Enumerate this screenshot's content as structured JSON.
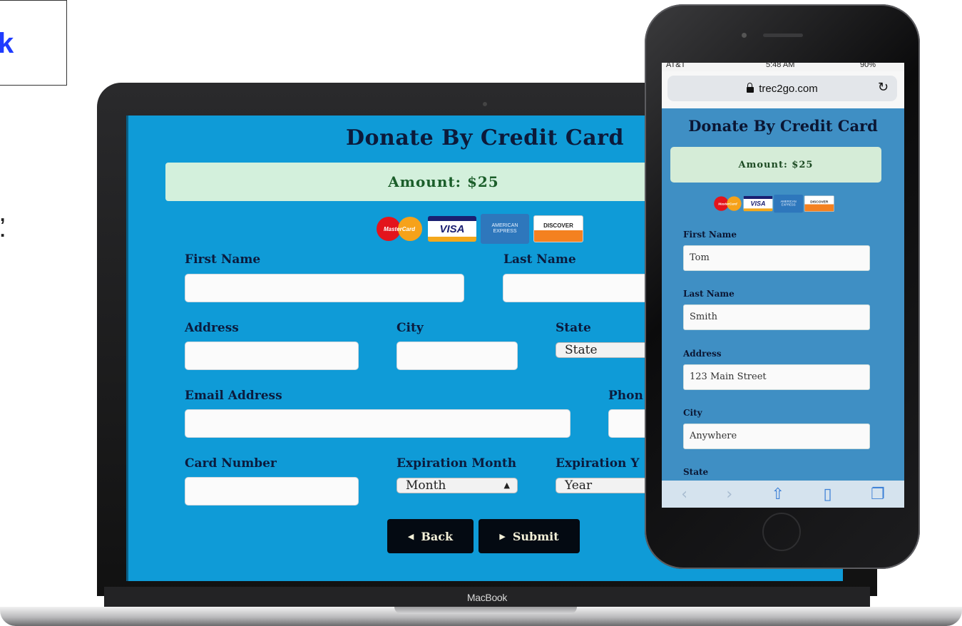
{
  "edge": {
    "char": "k",
    "punct": ",\n."
  },
  "laptop": {
    "brand_label": "MacBook",
    "form": {
      "title": "Donate By Credit Card",
      "amount": "Amount: $25",
      "cards": {
        "mastercard": "MasterCard",
        "visa": "VISA",
        "amex": "AMERICAN EXPRESS",
        "discover": "DISCOVER"
      },
      "labels": {
        "first_name": "First Name",
        "last_name": "Last Name",
        "address": "Address",
        "city": "City",
        "state": "State",
        "email": "Email Address",
        "phone": "Phon",
        "card_number": "Card Number",
        "exp_month": "Expiration Month",
        "exp_year": "Expiration Y"
      },
      "selects": {
        "state": "State",
        "month": "Month",
        "year": "Year"
      },
      "buttons": {
        "back": "Back",
        "submit": "Submit"
      }
    }
  },
  "phone": {
    "status": {
      "carrier": "AT&T",
      "time": "5:48 AM",
      "battery": "90%"
    },
    "url": "trec2go.com",
    "form": {
      "title": "Donate By Credit Card",
      "amount": "Amount: $25",
      "fields": [
        {
          "label": "First Name",
          "value": "Tom"
        },
        {
          "label": "Last Name",
          "value": "Smith"
        },
        {
          "label": "Address",
          "value": "123 Main Street"
        },
        {
          "label": "City",
          "value": "Anywhere"
        }
      ],
      "state_label": "State"
    }
  }
}
